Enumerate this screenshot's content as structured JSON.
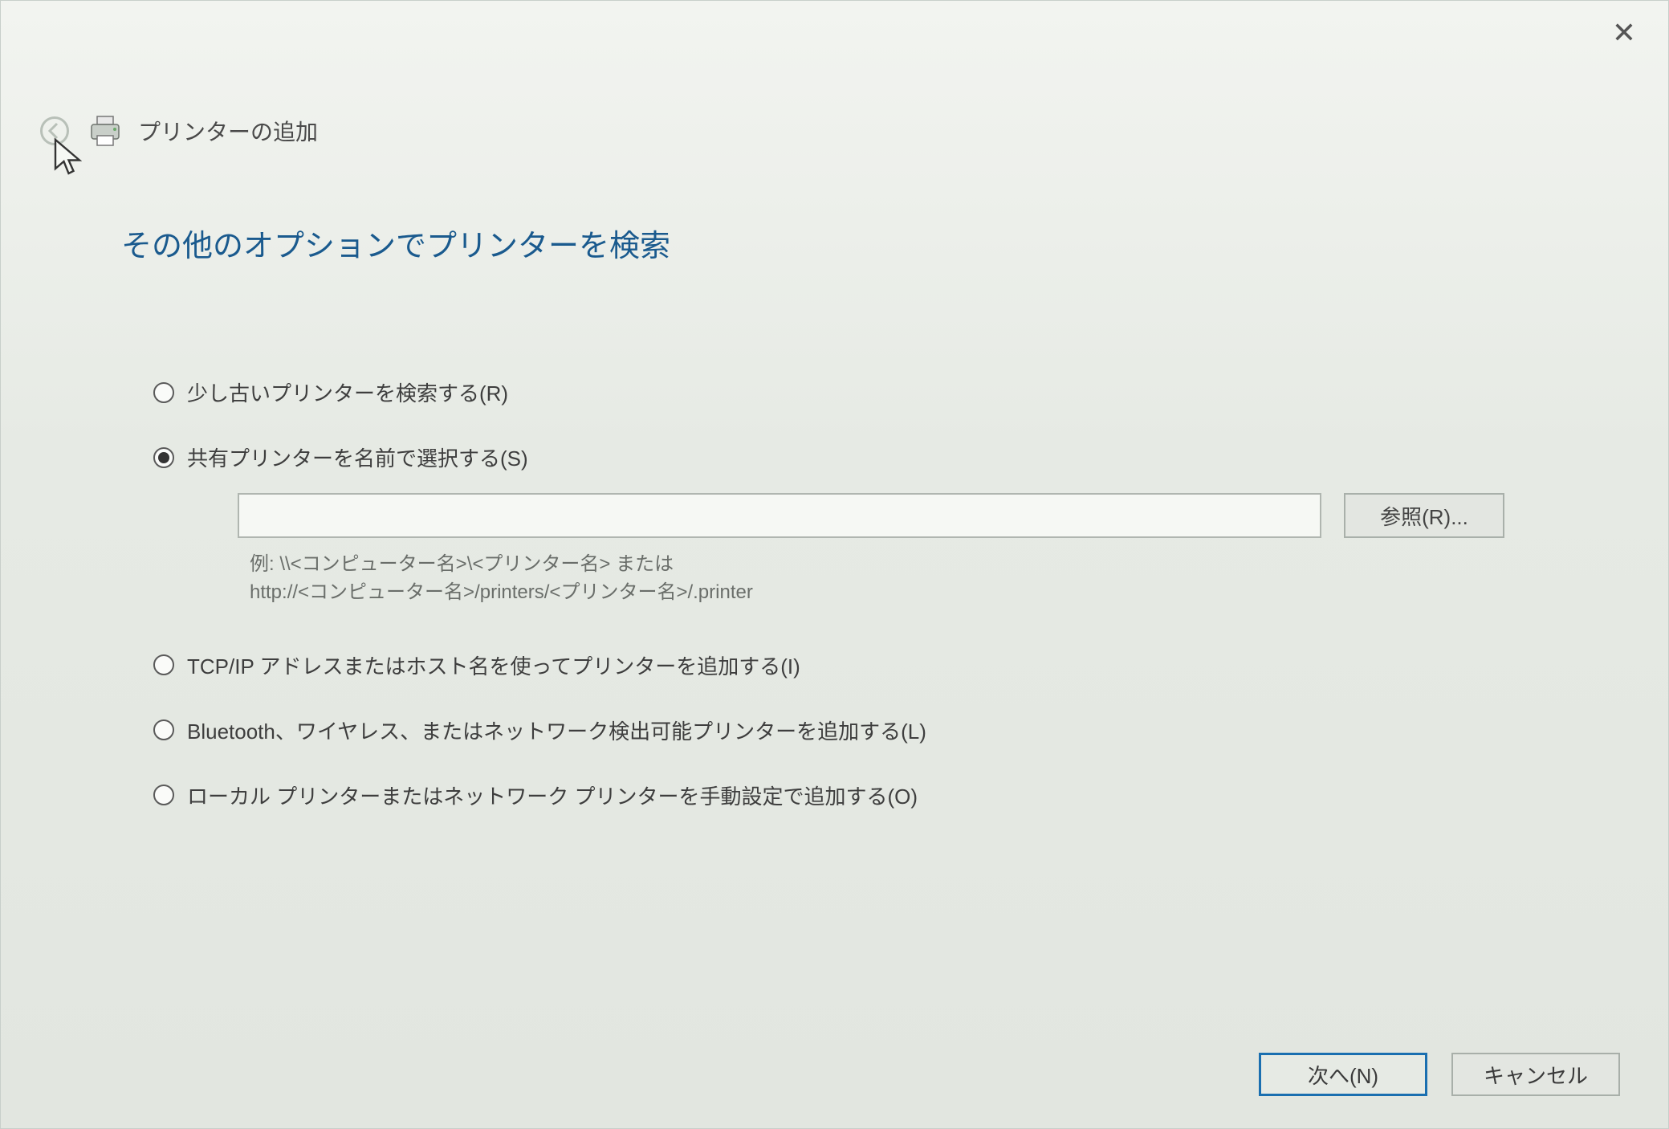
{
  "wizard": {
    "title": "プリンターの追加",
    "heading": "その他のオプションでプリンターを検索"
  },
  "options": {
    "older": "少し古いプリンターを検索する(R)",
    "shared": "共有プリンターを名前で選択する(S)",
    "shared_path_value": "",
    "browse_label": "参照(R)...",
    "example_line1": "例: \\\\<コンピューター名>\\<プリンター名> または",
    "example_line2": "http://<コンピューター名>/printers/<プリンター名>/.printer",
    "tcpip": "TCP/IP アドレスまたはホスト名を使ってプリンターを追加する(I)",
    "wireless": "Bluetooth、ワイヤレス、またはネットワーク検出可能プリンターを追加する(L)",
    "manual": "ローカル プリンターまたはネットワーク プリンターを手動設定で追加する(O)"
  },
  "footer": {
    "next": "次へ(N)",
    "cancel": "キャンセル"
  }
}
